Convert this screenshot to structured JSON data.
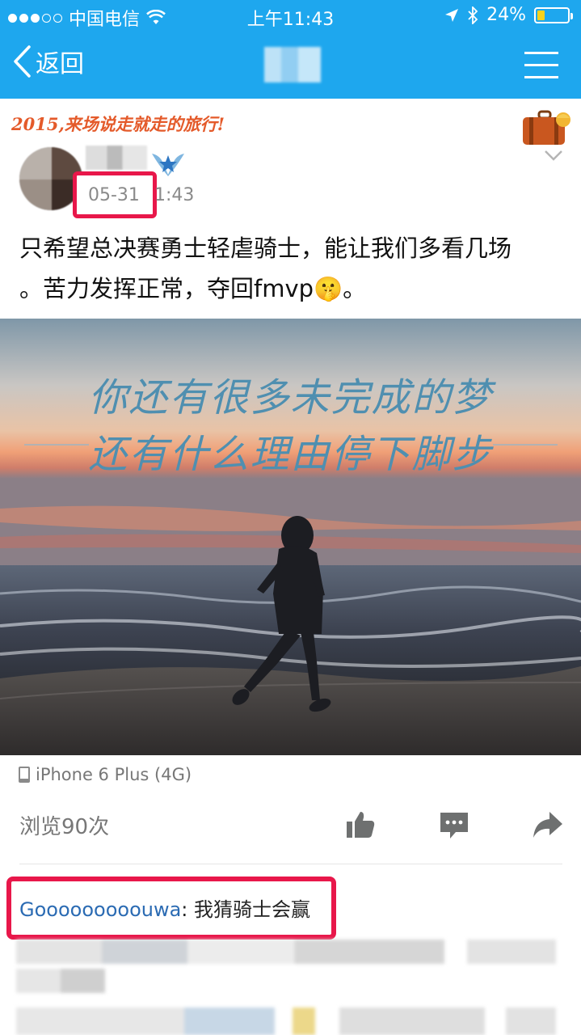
{
  "status_bar": {
    "carrier": "中国电信",
    "time": "上午11:43",
    "battery": "24%",
    "battery_level": 0.24
  },
  "nav": {
    "back_label": "返回"
  },
  "post": {
    "banner": "2015,来场说走就走的旅行!",
    "date": "05-31",
    "time": "1:43",
    "text_line1": "只希望总决赛勇士轻虐骑士，能让我们多看几场",
    "text_line2": "。苦力发挥正常，夺回fmvp🤫。",
    "image_text_line1": "你还有很多未完成的梦",
    "image_text_line2": "还有什么理由停下脚步",
    "device": "iPhone 6 Plus (4G)",
    "views": "浏览90次"
  },
  "comment": {
    "author": "Gooooooooouwa",
    "separator": ": ",
    "text": "我猜骑士会赢"
  },
  "colors": {
    "nav_bg": "#1ea7ee",
    "highlight": "#e8174a",
    "comment_author": "#2b6bb3",
    "banner": "#e45a2a"
  },
  "icons": [
    "back-chevron-icon",
    "menu-icon",
    "suitcase-icon",
    "chevron-down-icon",
    "rank-badge-icon",
    "phone-icon",
    "like-icon",
    "comment-icon",
    "share-icon",
    "wifi-icon",
    "location-icon",
    "bluetooth-icon",
    "battery-icon"
  ]
}
